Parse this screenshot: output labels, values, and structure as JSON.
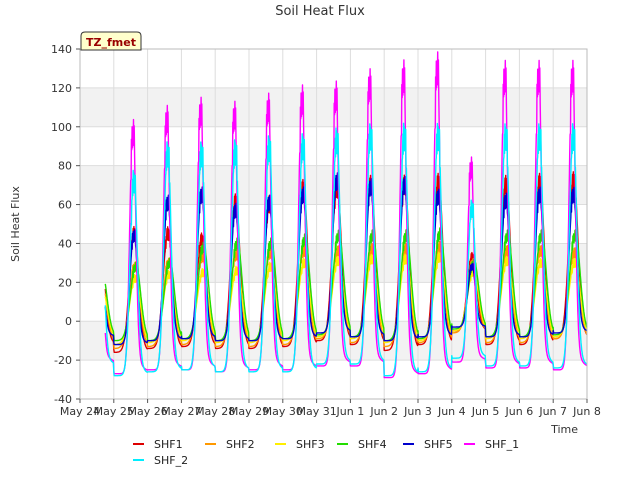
{
  "chart_data": {
    "type": "line",
    "title": "Soil Heat Flux",
    "xlabel": "Time",
    "ylabel": "Soil Heat Flux",
    "site_label": "TZ_fmet",
    "ylim": [
      -40,
      140
    ],
    "yticks": [
      -40,
      -20,
      0,
      20,
      40,
      60,
      80,
      100,
      120,
      140
    ],
    "xlim": [
      "2020-05-24",
      "2020-06-08"
    ],
    "xtick_labels": [
      "May 24",
      "May 25",
      "May 26",
      "May 27",
      "May 28",
      "May 29",
      "May 30",
      "May 31",
      "Jun 1",
      "Jun 2",
      "Jun 3",
      "Jun 4",
      "Jun 5",
      "Jun 6",
      "Jun 7",
      "Jun 8"
    ],
    "grid": true,
    "band_colors": [
      "#f2f2f2",
      "#ffffff"
    ],
    "legend_position": "bottom",
    "day_start": [
      "2020-05-24T18:00",
      "2020-05-25",
      "2020-05-26",
      "2020-05-27",
      "2020-05-28",
      "2020-05-29",
      "2020-05-30",
      "2020-05-31",
      "2020-06-01",
      "2020-06-02",
      "2020-06-03",
      "2020-06-04",
      "2020-06-05",
      "2020-06-06",
      "2020-06-07"
    ],
    "series": [
      {
        "name": "SHF1",
        "color": "#dd0000",
        "peak_hour": 14.2,
        "width_hours": 3.2,
        "daily_min": [
          -12,
          -16,
          -14,
          -13,
          -14,
          -14,
          -13,
          -10,
          -12,
          -15,
          -12,
          -5,
          -12,
          -12,
          -9
        ],
        "daily_max": [
          40,
          45,
          45,
          42,
          61,
          60,
          68,
          68,
          70,
          70,
          71,
          33,
          70,
          71,
          72
        ]
      },
      {
        "name": "SHF2",
        "color": "#ff9900",
        "peak_hour": 14.6,
        "width_hours": 3.6,
        "daily_min": [
          -11,
          -14,
          -13,
          -12,
          -13,
          -13,
          -12,
          -9,
          -11,
          -13,
          -11,
          -6,
          -11,
          -11,
          -9
        ],
        "daily_max": [
          25,
          28,
          30,
          33,
          34,
          35,
          36,
          36,
          37,
          37,
          38,
          30,
          36,
          36,
          35
        ]
      },
      {
        "name": "SHF3",
        "color": "#ffee00",
        "peak_hour": 15.0,
        "width_hours": 3.8,
        "daily_min": [
          -9,
          -12,
          -11,
          -10,
          -11,
          -11,
          -10,
          -8,
          -9,
          -11,
          -10,
          -5,
          -9,
          -9,
          -8
        ],
        "daily_max": [
          18,
          22,
          24,
          25,
          26,
          28,
          30,
          31,
          32,
          32,
          33,
          25,
          31,
          30,
          30
        ]
      },
      {
        "name": "SHF4",
        "color": "#22dd00",
        "peak_hour": 15.3,
        "width_hours": 3.6,
        "daily_min": [
          -8,
          -10,
          -10,
          -9,
          -10,
          -10,
          -9,
          -7,
          -8,
          -10,
          -9,
          -4,
          -8,
          -8,
          -7
        ],
        "daily_max": [
          25,
          28,
          30,
          38,
          40,
          40,
          42,
          44,
          44,
          44,
          45,
          30,
          44,
          44,
          44
        ]
      },
      {
        "name": "SHF5",
        "color": "#0000cc",
        "peak_hour": 14.0,
        "width_hours": 2.6,
        "daily_min": [
          -8,
          -12,
          -10,
          -9,
          -10,
          -10,
          -9,
          -6,
          -8,
          -10,
          -8,
          -3,
          -8,
          -8,
          -6
        ],
        "daily_max": [
          35,
          44,
          61,
          65,
          57,
          61,
          65,
          72,
          69,
          70,
          64,
          28,
          62,
          65,
          65
        ]
      },
      {
        "name": "SHF_1",
        "color": "#ff00ff",
        "peak_hour": 13.4,
        "width_hours": 2.1,
        "daily_min": [
          -22,
          -27,
          -25,
          -25,
          -26,
          -25,
          -25,
          -23,
          -23,
          -29,
          -27,
          -21,
          -24,
          -24,
          -25
        ],
        "daily_max": [
          93,
          97,
          104,
          108,
          106,
          110,
          114,
          116,
          122,
          126,
          130,
          79,
          126,
          126,
          126
        ]
      },
      {
        "name": "SHF_2",
        "color": "#00eeff",
        "peak_hour": 14.0,
        "width_hours": 2.5,
        "daily_min": [
          -23,
          -28,
          -26,
          -25,
          -26,
          -26,
          -26,
          -22,
          -22,
          -28,
          -26,
          -19,
          -23,
          -23,
          -24
        ],
        "daily_max": [
          71,
          72,
          86,
          86,
          87,
          89,
          90,
          93,
          95,
          95,
          95,
          58,
          95,
          95,
          95
        ]
      }
    ]
  }
}
